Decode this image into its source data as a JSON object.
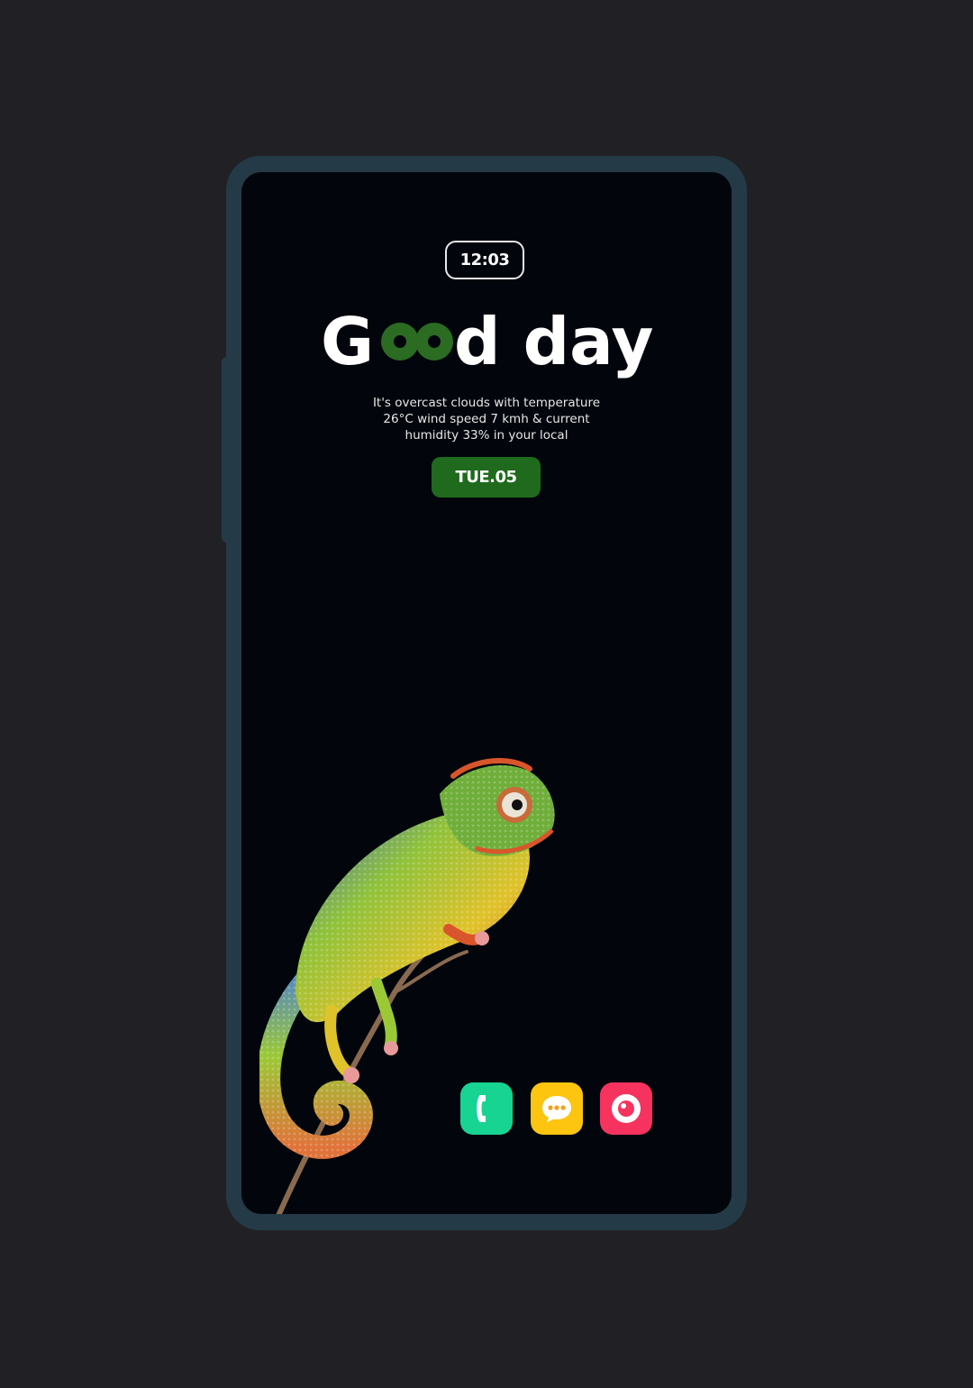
{
  "status": {
    "time": "12:03"
  },
  "greeting": {
    "prefix": "G",
    "suffix": "d day",
    "highlight_color": "#2b6b22",
    "text_color": "#ffffff"
  },
  "weather": {
    "line1": "It's overcast clouds with temperature",
    "line2": "26°C wind speed 7 kmh & current",
    "line3": "humidity 33% in your local"
  },
  "date": {
    "label": "TUE.05"
  },
  "dock": {
    "apps": [
      {
        "name": "phone",
        "icon": "phone-icon",
        "color": "#17d493"
      },
      {
        "name": "messages",
        "icon": "chat-bubble-icon",
        "color": "#fdc410"
      },
      {
        "name": "camera",
        "icon": "camera-icon",
        "color": "#f6335f"
      }
    ]
  },
  "wallpaper": {
    "subject": "chameleon-on-branch"
  },
  "colors": {
    "background": "#212125",
    "frame": "#253a47",
    "screen": "#02060c",
    "date_pill": "#1f6a1d"
  }
}
